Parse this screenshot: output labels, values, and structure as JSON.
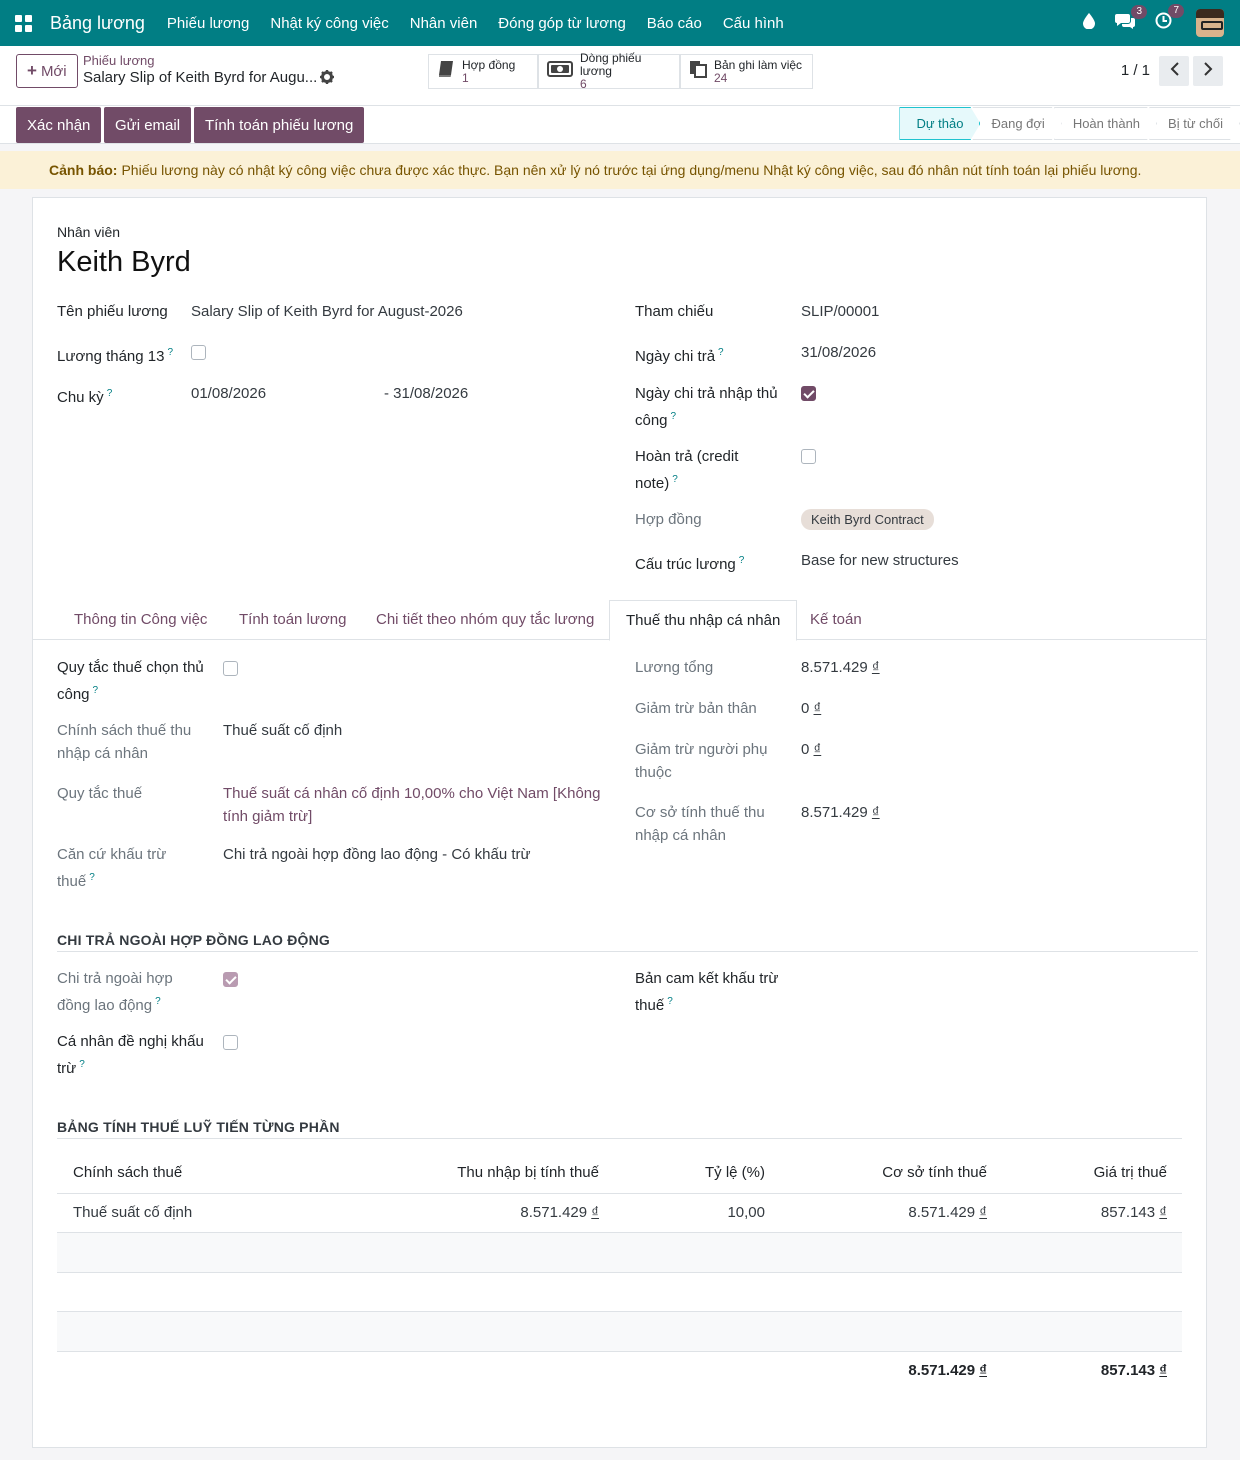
{
  "navbar": {
    "brand": "Bảng lương",
    "menu": [
      "Phiếu lương",
      "Nhật ký công việc",
      "Nhân viên",
      "Đóng góp từ lương",
      "Báo cáo",
      "Cấu hình"
    ],
    "messages_badge": "3",
    "activities_badge": "7"
  },
  "control": {
    "new_label": "Mới",
    "breadcrumb_parent": "Phiếu lương",
    "breadcrumb_current": "Salary Slip of Keith Byrd for Augu...",
    "smart_buttons": [
      {
        "label": "Hợp đồng",
        "value": "1"
      },
      {
        "label": "Dòng phiếu lương",
        "value": "6"
      },
      {
        "label": "Bản ghi làm việc",
        "value": "24"
      }
    ],
    "pager": "1 / 1"
  },
  "actions": {
    "confirm": "Xác nhận",
    "send_email": "Gửi email",
    "compute": "Tính toán phiếu lương"
  },
  "statusbar": [
    "Dự thảo",
    "Đang đợi",
    "Hoàn thành",
    "Bị từ chối"
  ],
  "warning": {
    "title": "Cảnh báo:",
    "text": "Phiếu lương này có nhật ký công việc chưa được xác thực. Bạn nên xử lý nó trước tại ứng dụng/menu Nhật ký công việc, sau đó nhân nút tính toán lại phiếu lương."
  },
  "form": {
    "employee_label": "Nhân viên",
    "employee_name": "Keith Byrd",
    "slip_name_label": "Tên phiếu lương",
    "slip_name": "Salary Slip of Keith Byrd for August-2026",
    "thirteenth_label": "Lương tháng 13",
    "period_label": "Chu kỳ",
    "period_from": "01/08/2026",
    "period_to": "- 31/08/2026",
    "reference_label": "Tham chiếu",
    "reference": "SLIP/00001",
    "pay_date_label": "Ngày chi trả",
    "pay_date": "31/08/2026",
    "manual_pay_date_label_1": "Ngày chi trả nhập thủ",
    "manual_pay_date_label_2": "công",
    "refund_label_1": "Hoàn trả (credit",
    "refund_label_2": "note)",
    "contract_label": "Hợp đồng",
    "contract": "Keith Byrd Contract",
    "structure_label": "Cấu trúc lương",
    "structure": "Base for new structures"
  },
  "tabs": [
    "Thông tin Công việc",
    "Tính toán lương",
    "Chi tiết theo nhóm quy tắc lương",
    "Thuế thu nhập cá nhân",
    "Kế toán"
  ],
  "tax": {
    "manual_rule_label_1": "Quy tắc thuế chọn thủ",
    "manual_rule_label_2": "công",
    "policy_label_1": "Chính sách thuế thu",
    "policy_label_2": "nhập cá nhân",
    "policy": "Thuế suất cố định",
    "rule_label": "Quy tắc thuế",
    "rule_1": "Thuế suất cá nhân cố định 10,00% cho Việt Nam [Không",
    "rule_2": "tính giảm trừ]",
    "basis_label_1": "Căn cứ khấu trừ",
    "basis_label_2": "thuế",
    "basis": "Chi trả ngoài hợp đồng lao động - Có khấu trừ",
    "gross_label": "Lương tổng",
    "gross": "8.571.429",
    "self_deduct_label": "Giảm trừ bản thân",
    "self_deduct": "0",
    "dependent_label_1": "Giảm trừ người phụ",
    "dependent_label_2": "thuộc",
    "dependent": "0",
    "taxbase_label_1": "Cơ sở tính thuế thu",
    "taxbase_label_2": "nhập cá nhân",
    "taxbase": "8.571.429",
    "currency": "₫"
  },
  "outside": {
    "title": "CHI TRẢ NGOÀI HỢP ĐỒNG LAO ĐỘNG",
    "outside_label_1": "Chi trả ngoài hợp",
    "outside_label_2": "đồng lao động",
    "request_label_1": "Cá nhân đề nghị khấu",
    "request_label_2": "trừ",
    "commit_label_1": "Bản cam kết khấu trừ",
    "commit_label_2": "thuế"
  },
  "progressive": {
    "title": "BẢNG TÍNH THUẾ LUỸ TIẾN TỪNG PHẦN",
    "headers": [
      "Chính sách thuế",
      "Thu nhập bị tính thuế",
      "Tỷ lệ (%)",
      "Cơ sở tính thuế",
      "Giá trị thuế"
    ],
    "row": [
      "Thuế suất cố định",
      "8.571.429",
      "10,00",
      "8.571.429",
      "857.143"
    ],
    "total_base": "8.571.429",
    "total_tax": "857.143"
  },
  "colors": {
    "navbar": "#017e84",
    "primary": "#714b67",
    "warning_bg": "#fbf1d7"
  }
}
